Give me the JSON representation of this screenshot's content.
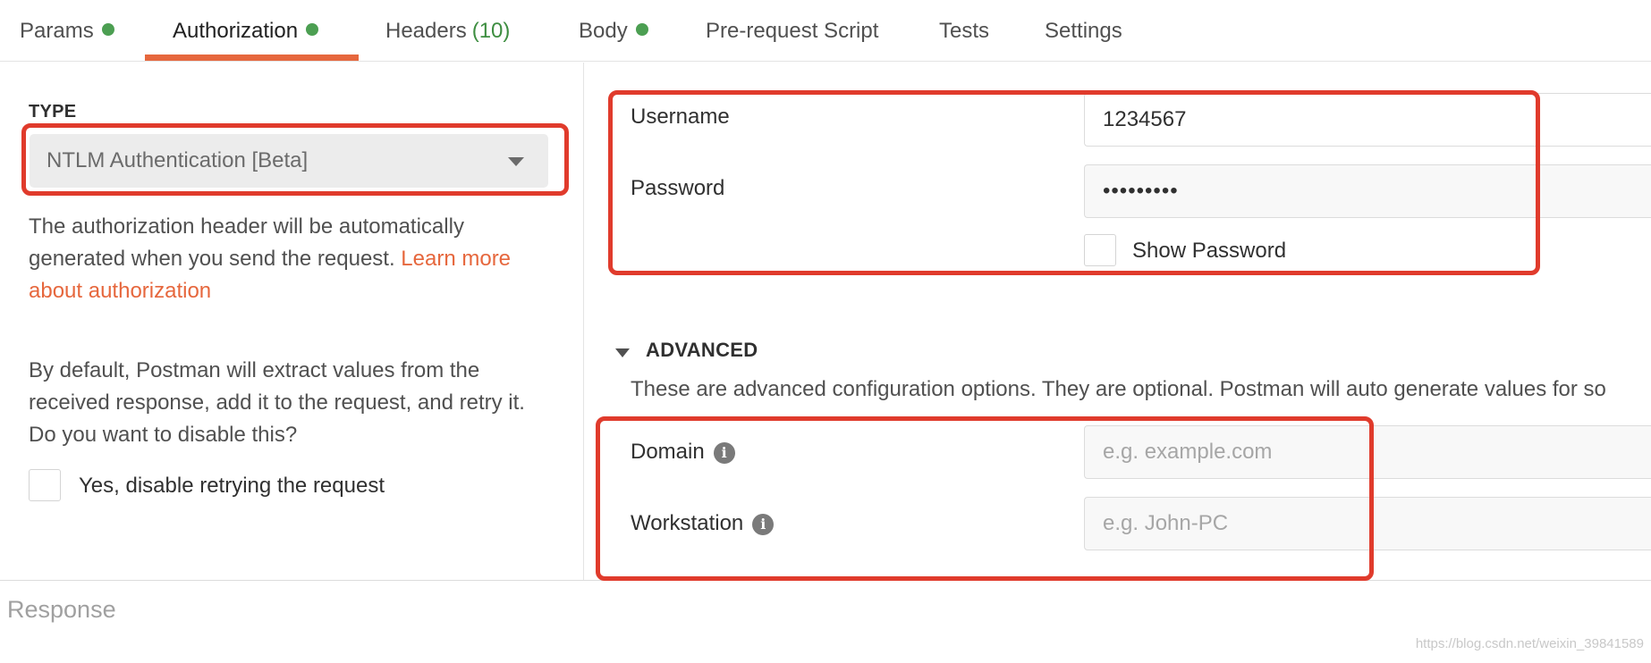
{
  "tabs": [
    {
      "label": "Params",
      "dot": true
    },
    {
      "label": "Authorization",
      "dot": true,
      "active": true
    },
    {
      "label": "Headers",
      "count": "(10)"
    },
    {
      "label": "Body",
      "dot": true
    },
    {
      "label": "Pre-request Script"
    },
    {
      "label": "Tests"
    },
    {
      "label": "Settings"
    }
  ],
  "colors": {
    "dot": "#4c9f52",
    "count": "#3e8e41",
    "accent": "#e6673d",
    "annotation": "#e03b2c"
  },
  "auth": {
    "type_label": "TYPE",
    "type_value": "NTLM Authentication [Beta]",
    "help_text": "The authorization header will be automatically generated when you send the request. ",
    "help_link": "Learn more about authorization",
    "retry_text": "By default, Postman will extract values from the received response, add it to the request, and retry it. Do you want to disable this?",
    "retry_checkbox_label": "Yes, disable retrying the request"
  },
  "fields": {
    "username_label": "Username",
    "username_value": "1234567",
    "password_label": "Password",
    "password_value": "•••••••••",
    "show_password_label": "Show Password"
  },
  "advanced": {
    "title": "ADVANCED",
    "description": "These are advanced configuration options. They are optional. Postman will auto generate values for so",
    "domain_label": "Domain",
    "domain_placeholder": "e.g. example.com",
    "workstation_label": "Workstation",
    "workstation_placeholder": "e.g. John-PC",
    "info_glyph": "i"
  },
  "response": {
    "label": "Response"
  },
  "watermark": "https://blog.csdn.net/weixin_39841589"
}
